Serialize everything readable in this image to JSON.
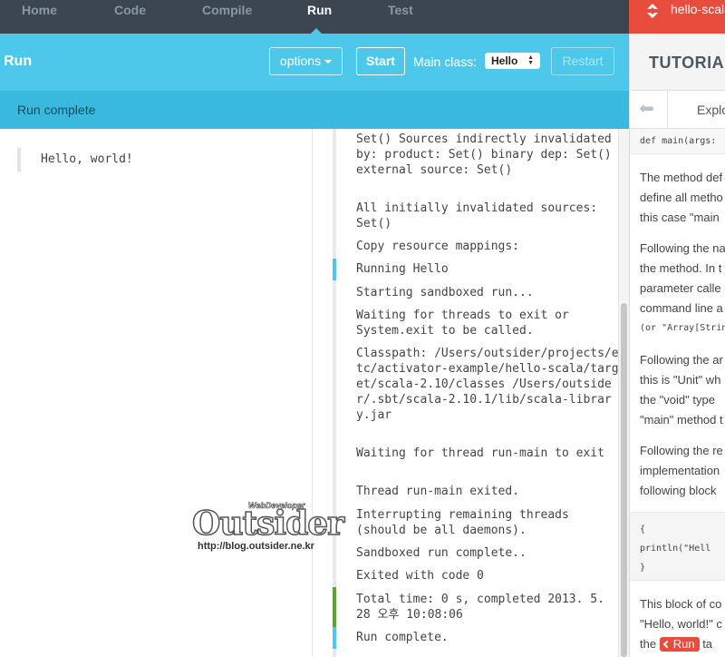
{
  "nav": {
    "tabs": [
      "Home",
      "Code",
      "Compile",
      "Run",
      "Test"
    ],
    "active": "Run"
  },
  "project": {
    "name": "hello-scala",
    "icon": "activator-logo-icon",
    "color": "#e84c3d"
  },
  "runbar": {
    "title": "Run",
    "options_label": "options",
    "start_label": "Start",
    "main_class_label": "Main class:",
    "main_class_value": "Hello",
    "restart_label": "Restart",
    "color": "#4ec8ea"
  },
  "status": {
    "text": "Run complete"
  },
  "output": {
    "lines": [
      "Hello, world!"
    ]
  },
  "log": {
    "entries": [
      "Set() Sources indirectly invalidated by: product: Set() binary dep: Set() external source: Set()",
      "All initially invalidated sources: Set()",
      "Copy resource mappings:",
      "Running Hello",
      "Starting sandboxed run...",
      "Waiting for threads to exit or System.exit to be called.",
      "Classpath: /Users/outsider/projects/etc/activator-example/hello-scala/target/scala-2.10/classes /Users/outsider/.sbt/scala-2.10.1/lib/scala-library.jar",
      "Waiting for thread run-main to exit",
      "Thread run-main exited.",
      "Interrupting remaining threads (should be all daemons).",
      "Sandboxed run complete..",
      "Exited with code 0",
      "Total time: 0 s, completed 2013. 5. 28 오후 10:08:06",
      "Run complete."
    ],
    "marker_colors": {
      "info": "#4ec8ea",
      "success": "#5aa52a"
    }
  },
  "tutorial": {
    "title": "TUTORIAL",
    "nav_label": "Explo",
    "code_strip": "def main(args:",
    "p1": [
      "The method def",
      "define all metho",
      "this case \"main"
    ],
    "p2": [
      "Following the na",
      "the method. In t",
      "parameter calle",
      "command line a",
      "(or \"Array[Strin"
    ],
    "p3_lines": [
      "Following the ar",
      "this is \"Unit\" wh",
      "the \"void\" type",
      "\"main\" method t"
    ],
    "p4": [
      "Following the re",
      "implementation",
      "following block"
    ],
    "code_block": [
      "{",
      "  println(\"Hell",
      "}"
    ],
    "p5": [
      "This block of co",
      "\"Hello, world!\" c"
    ],
    "p5_last_prefix": "the",
    "run_chip_label": "Run",
    "p5_last_suffix": "ta"
  },
  "watermark": {
    "top": "WebDeveloper",
    "main": "Outsider",
    "url": "http://blog.outsider.ne.kr"
  }
}
